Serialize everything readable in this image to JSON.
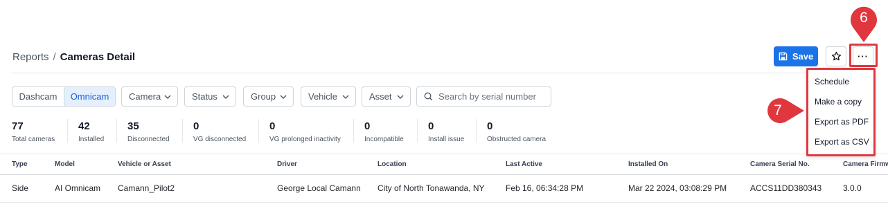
{
  "breadcrumb": {
    "root": "Reports",
    "separator": "/",
    "current": "Cameras Detail"
  },
  "toolbar": {
    "save_label": "Save",
    "more_label": "···"
  },
  "filters": {
    "view_toggle": [
      "Dashcam",
      "Omnicam"
    ],
    "view_selected": "Omnicam",
    "dropdowns": [
      "Camera",
      "Status",
      "Group",
      "Vehicle",
      "Asset"
    ],
    "search_placeholder": "Search by serial number"
  },
  "stats": [
    {
      "value": "77",
      "label": "Total cameras"
    },
    {
      "value": "42",
      "label": "Installed"
    },
    {
      "value": "35",
      "label": "Disconnected"
    },
    {
      "value": "0",
      "label": "VG disconnected"
    },
    {
      "value": "0",
      "label": "VG prolonged inactivity"
    },
    {
      "value": "0",
      "label": "Incompatible"
    },
    {
      "value": "0",
      "label": "Install issue"
    },
    {
      "value": "0",
      "label": "Obstructed camera"
    }
  ],
  "table": {
    "columns": [
      "Type",
      "Model",
      "Vehicle or Asset",
      "Driver",
      "Location",
      "Last Active",
      "Installed On",
      "Camera Serial No.",
      "Camera Firmw"
    ],
    "rows": [
      [
        "Side",
        "AI Omnicam",
        "Camann_Pilot2",
        "George Local Camann",
        "City of North Tonawanda, NY",
        "Feb 16, 06:34:28 PM",
        "Mar 22 2024, 03:08:29 PM",
        "ACCS11DD380343",
        "3.0.0"
      ]
    ]
  },
  "more_menu": {
    "items": [
      "Schedule",
      "Make a copy",
      "Export as PDF",
      "Export as CSV"
    ]
  },
  "annotations": {
    "marker_6": "6",
    "marker_7": "7"
  },
  "colors": {
    "accent": "#1a73e8",
    "annotation": "#e0373f",
    "selected_bg": "#e4f0fd"
  }
}
